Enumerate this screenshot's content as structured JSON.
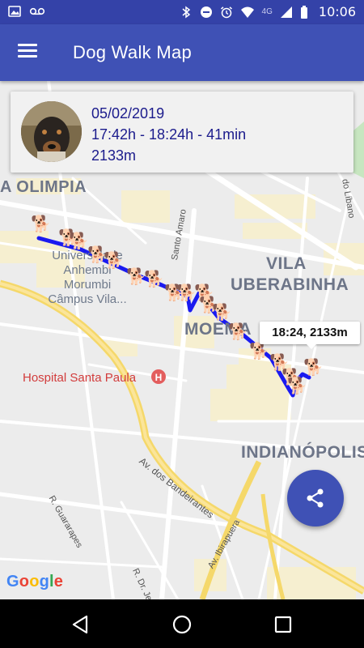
{
  "status_bar": {
    "time": "10:06",
    "network": "4G",
    "left_icons": [
      "image-icon",
      "voicemail-icon"
    ],
    "right_icons": [
      "bluetooth-icon",
      "do-not-disturb-icon",
      "alarm-icon",
      "wifi-icon",
      "signal-icon",
      "battery-icon"
    ]
  },
  "app_bar": {
    "title": "Dog Walk Map",
    "menu_icon": "hamburger-menu-icon"
  },
  "walk_info": {
    "date": "05/02/2019",
    "time_range": "17:42h - 18:24h - 41min",
    "distance": "2133m"
  },
  "map": {
    "neighborhoods": [
      "A OLIMPIA",
      "VILA",
      "UBERABINHA",
      "MOEMA",
      "INDIANÓPOLIS"
    ],
    "poi": {
      "university_lines": [
        "Universidade",
        "Anhembi",
        "Morumbi",
        "Câmpus Vila..."
      ],
      "hospital": "Hospital Santa Paula"
    },
    "streets": {
      "santo_amaro": "Santo Amaro",
      "bandeirantes": "Av. dos Bandeirantes",
      "guararapes": "R. Guararapes",
      "ibirapuera": "Av. Ibirapuera",
      "dr_jesuino": "R. Dr. Jes",
      "do_libano": "do Líbano"
    },
    "callout": "18:24, 2133m",
    "attribution": "Google",
    "route_color": "#1a1af0"
  },
  "share_button_icon": "share-icon",
  "nav": {
    "back_icon": "back-triangle-icon",
    "home_icon": "home-circle-icon",
    "recents_icon": "recents-square-icon"
  },
  "colors": {
    "primary": "#3f51b5",
    "primary_dark": "#3442a8",
    "info_text": "#1b1b8c"
  }
}
